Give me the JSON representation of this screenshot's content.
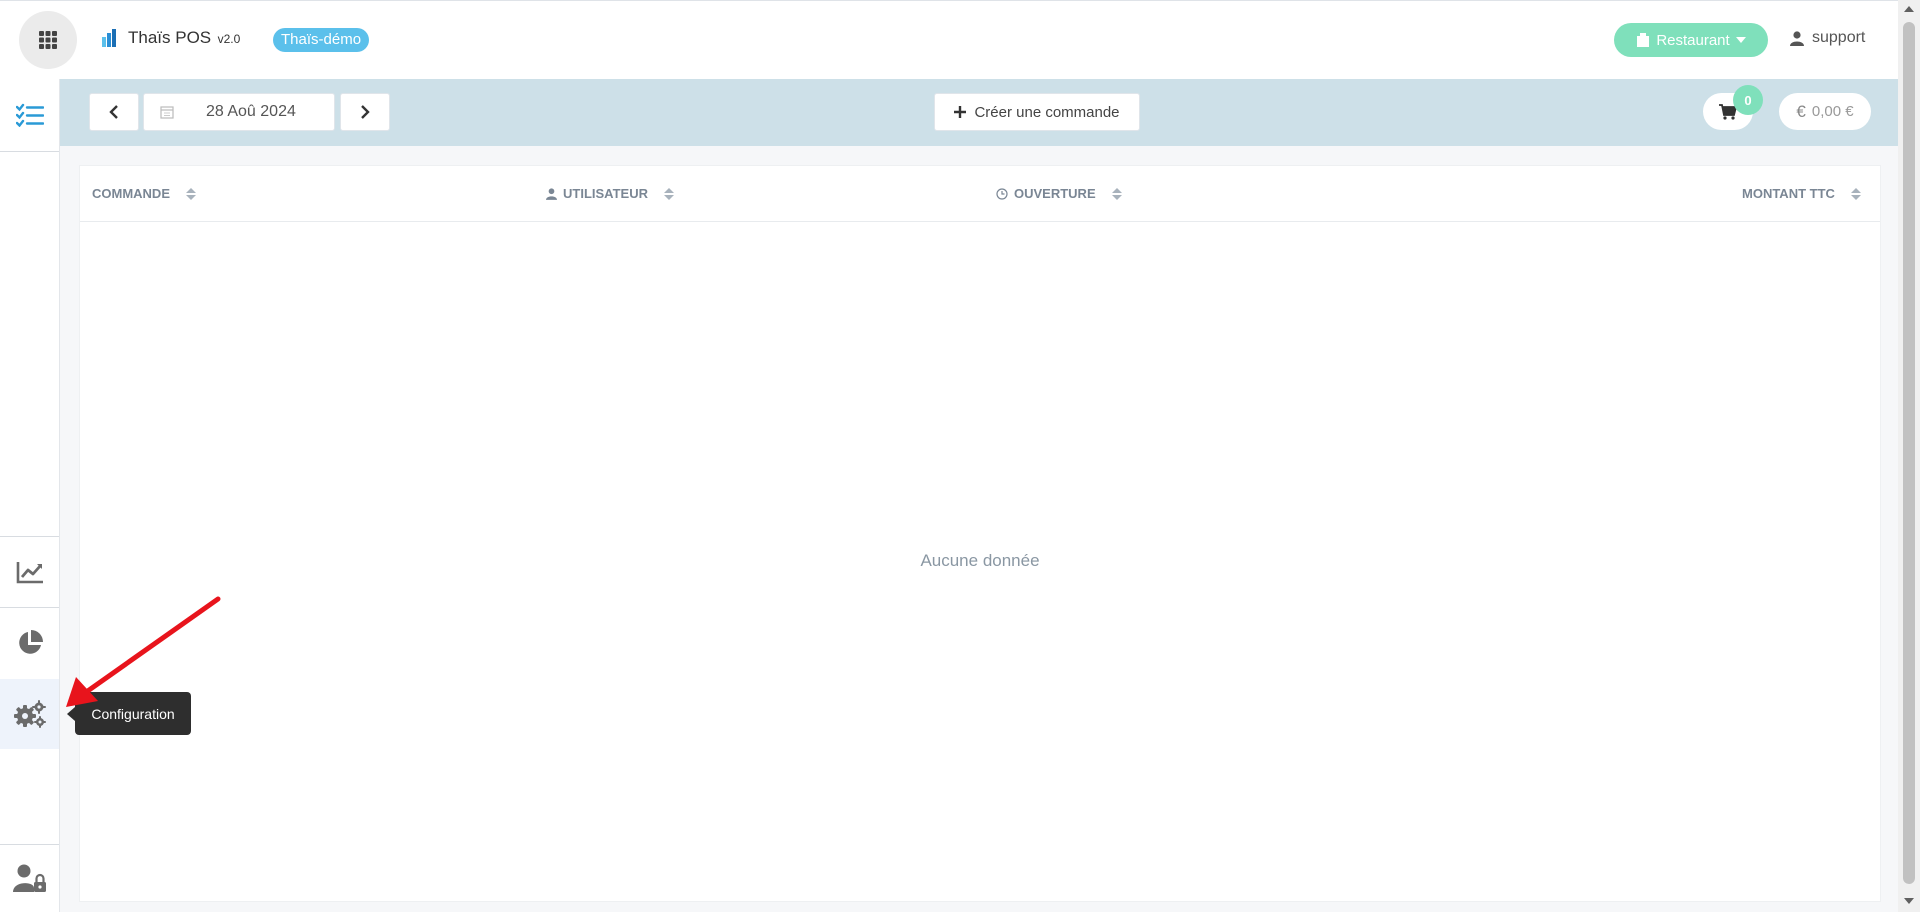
{
  "header": {
    "app_name": "Thaïs POS",
    "version": "v2.0",
    "environment_badge": "Thaïs-démo",
    "establishment_label": "Restaurant",
    "user_label": "support"
  },
  "toolbar": {
    "date_value": "28 Aoû 2024",
    "create_order_label": "Créer une commande",
    "cart_count": "0",
    "currency_symbol": "€",
    "total_amount": "0,00 €"
  },
  "table": {
    "columns": [
      {
        "label": "COMMANDE",
        "icon": "none"
      },
      {
        "label": "UTILISATEUR",
        "icon": "user-icon"
      },
      {
        "label": "OUVERTURE",
        "icon": "clock-icon"
      },
      {
        "label": "MONTANT TTC",
        "icon": "none"
      }
    ],
    "empty_message": "Aucune donnée"
  },
  "sidebar": {
    "items": [
      {
        "name": "orders",
        "icon": "checklist-icon",
        "active": true
      },
      {
        "name": "statistics",
        "icon": "chart-line-icon"
      },
      {
        "name": "reports",
        "icon": "pie-chart-icon"
      },
      {
        "name": "configuration",
        "icon": "gears-icon",
        "hovered": true
      },
      {
        "name": "user-lock",
        "icon": "user-lock-icon"
      }
    ]
  },
  "tooltip": {
    "text": "Configuration"
  },
  "colors": {
    "accent_blue": "#5bc0eb",
    "accent_green": "#7fe0bb",
    "toolbar_bg": "#cde0e8",
    "annotation_red": "#e8141c"
  }
}
